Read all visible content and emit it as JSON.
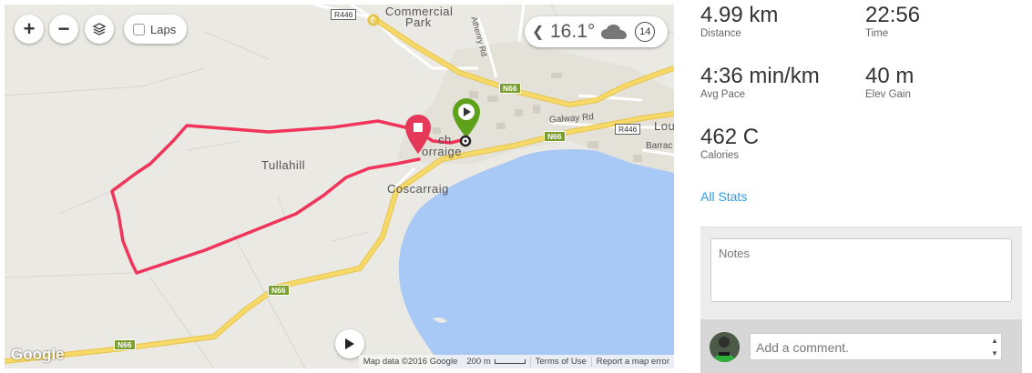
{
  "map": {
    "zoom_in_label": "+",
    "zoom_out_label": "−",
    "laps_label": "Laps",
    "weather": {
      "temperature": "16.1°",
      "wind_speed": "14"
    },
    "attribution": {
      "map_data": "Map data ©2016 Google",
      "scale": "200 m",
      "terms": "Terms of Use",
      "report": "Report a map error"
    },
    "google_logo": "Google",
    "labels": {
      "commercial": "Commercial",
      "park": "Park",
      "athenry": "Athenry Rd",
      "galway": "Galway Rd",
      "lou": "Lou",
      "barrac": "Barrac",
      "tullahill": "Tullahill",
      "coscarraig": "Coscarraig",
      "ch": "ch",
      "orraige": "orraige"
    },
    "road_tags": {
      "r446_top": "R446",
      "r446_right": "R446",
      "n66_a": "N66",
      "n66_b": "N66",
      "n66_c": "N66",
      "n66_d": "N66"
    }
  },
  "stats": {
    "distance": {
      "value": "4.99 km",
      "label": "Distance"
    },
    "time": {
      "value": "22:56",
      "label": "Time"
    },
    "pace": {
      "value": "4:36 min/km",
      "label": "Avg Pace"
    },
    "elev": {
      "value": "40 m",
      "label": "Elev Gain"
    },
    "calories": {
      "value": "462 C",
      "label": "Calories"
    },
    "all_stats_link": "All Stats"
  },
  "notes": {
    "placeholder": "Notes"
  },
  "comment": {
    "placeholder": "Add a comment."
  },
  "colors": {
    "route": "#f0345a",
    "start_pin": "#5ea11b",
    "end_pin": "#e5395a",
    "water": "#a8c9f5",
    "road_major": "#f7d96a",
    "link": "#2e9be6"
  }
}
